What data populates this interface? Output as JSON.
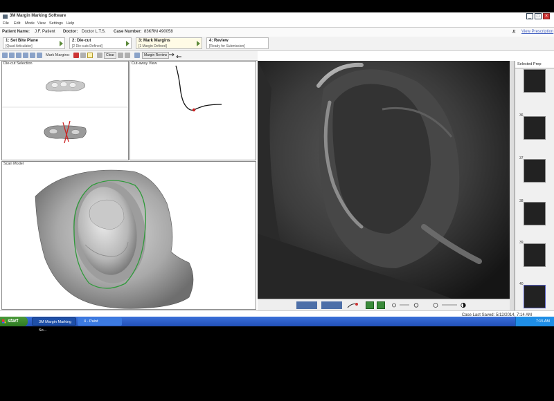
{
  "window": {
    "title": "3M Margin Marking Software",
    "menu": [
      "File",
      "Edit",
      "Mode",
      "View",
      "Settings",
      "Help"
    ]
  },
  "info": {
    "patient_label": "Patient Name:",
    "patient": "J.F. Patient",
    "doctor_label": "Doctor:",
    "doctor": "Doctor L.T.S.",
    "case_label": "Case Number:",
    "case_number": "83KRM 490058",
    "logo": "R",
    "view_prescription": "View Prescription"
  },
  "steps": [
    {
      "title": "1: Set Bite Plane",
      "status": "[Quad Articulator]"
    },
    {
      "title": "2: Die-cut",
      "status": "[2 Die-cuts Defined]"
    },
    {
      "title": "3: Mark Margins",
      "status": "[1 Margin Defined]"
    },
    {
      "title": "4: Review",
      "status": "[Ready for Submission]"
    }
  ],
  "toolbar": {
    "mark_margins_label": "Mark Margins:",
    "clear_label": "Clear",
    "margin_review_label": "Margin Review"
  },
  "panels": {
    "die_cut": "Die-cut Selection",
    "cutaway": "Cut-away View",
    "scan_model": "Scan Model"
  },
  "side": {
    "header": "Selected Prep",
    "thumbnails": [
      "",
      "36",
      "37",
      "38",
      "39",
      "40"
    ]
  },
  "status": {
    "last_saved": "Case Last Saved: 5/12/2014, 7:14 AM"
  },
  "taskbar": {
    "start": "start",
    "tasks": [
      "3M Margin Marking So...",
      "4 - Paint"
    ],
    "clock": "7:15 AM"
  },
  "colors": {
    "margin_line": "#2f9a3a",
    "step_arrow": "#5c8a3a",
    "link": "#4a66c4",
    "taskbar": "#2250b8"
  }
}
